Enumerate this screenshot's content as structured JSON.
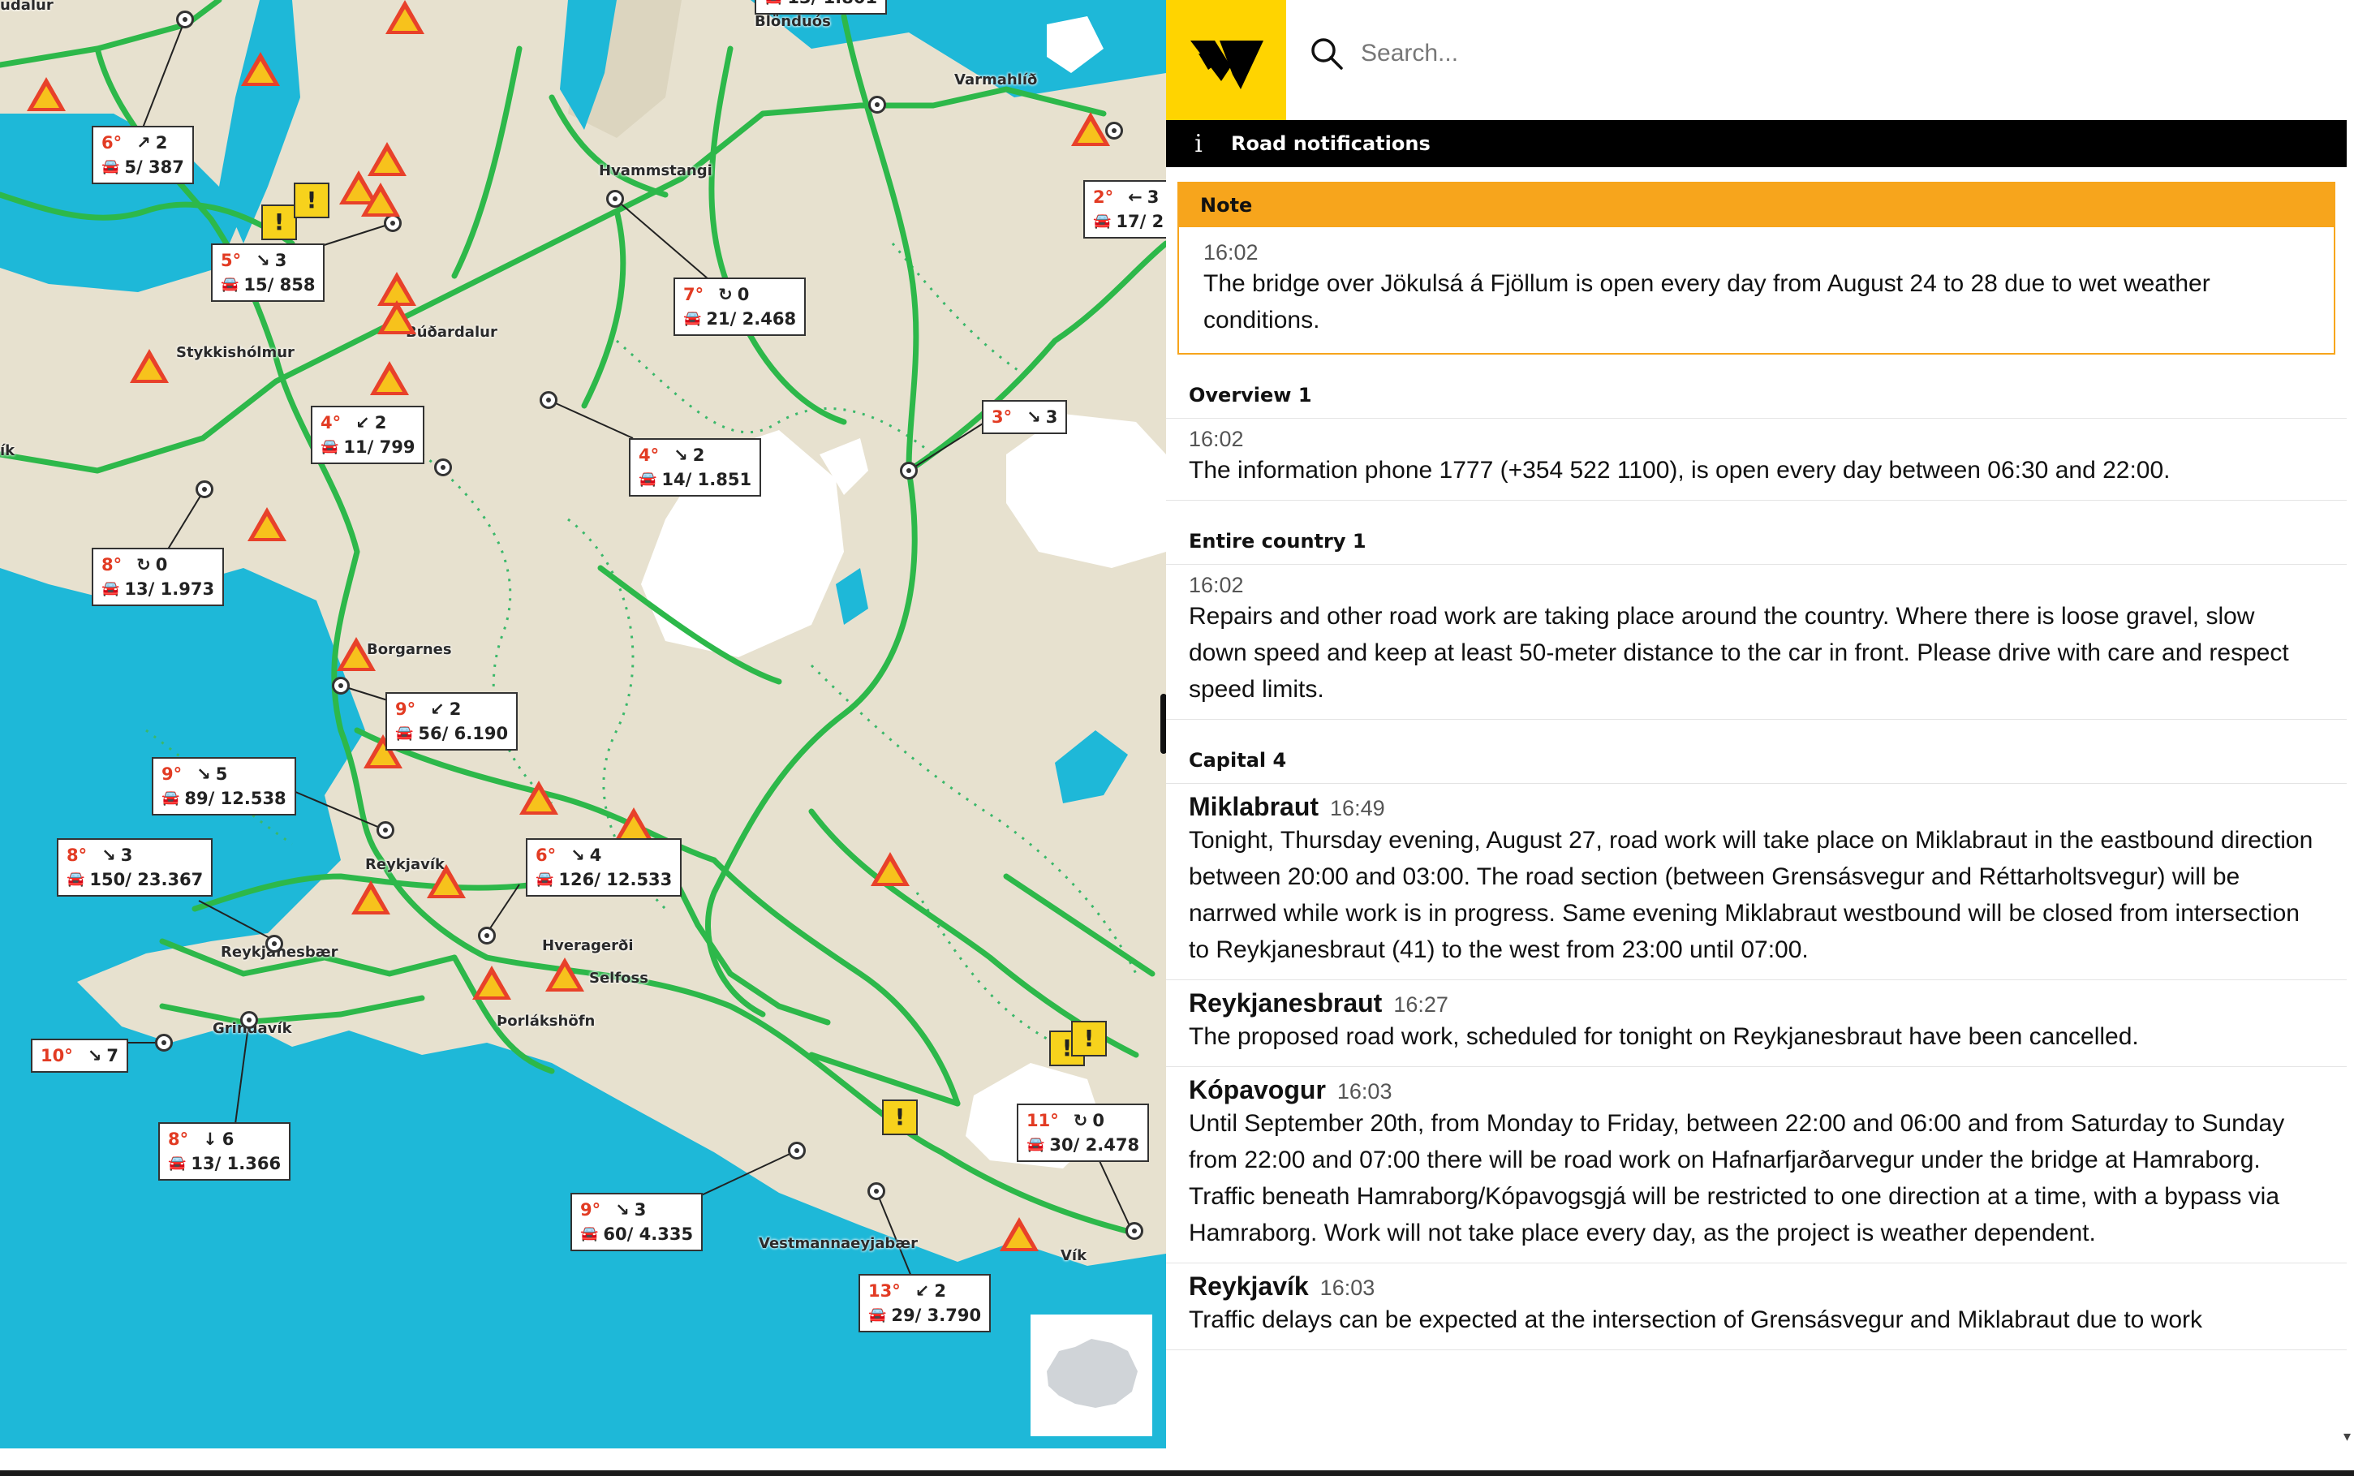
{
  "search": {
    "placeholder": "Search..."
  },
  "notifications": {
    "bar_title": "Road notifications",
    "note": {
      "label": "Note",
      "time": "16:02",
      "text": "The bridge over Jökulsá á Fjöllum is open every day from August 24 to 28 due to wet weather conditions."
    },
    "sections": [
      {
        "head": "Overview 1",
        "items": [
          {
            "title": "",
            "time": "16:02",
            "text": "The information phone 1777 (+354 522 1100), is open every day between 06:30 and 22:00."
          }
        ]
      },
      {
        "head": "Entire country 1",
        "items": [
          {
            "title": "",
            "time": "16:02",
            "text": "Repairs and other road work are taking place around the country. Where there is loose gravel, slow down speed and keep at least 50-meter distance to the car in front. Please drive with care and respect speed limits."
          }
        ]
      },
      {
        "head": "Capital 4",
        "items": [
          {
            "title": "Miklabraut",
            "time": "16:49",
            "text": "Tonight, Thursday evening, August 27, road work will take place on Miklabraut in the eastbound direction between 20:00 and 03:00. The road section (between Grensásvegur and Réttarholtsvegur) will be narrwed while work is in progress. Same evening Miklabraut westbound will be closed from intersection to Reykjanesbraut (41) to the west from 23:00 until 07:00."
          },
          {
            "title": "Reykjanesbraut",
            "time": "16:27",
            "text": "The proposed road work, scheduled for tonight on Reykjanesbraut have been cancelled."
          },
          {
            "title": "Kópavogur",
            "time": "16:03",
            "text": "Until September 20th, from Monday to Friday, between 22:00 and 06:00 and from Saturday to Sunday from 22:00 and 07:00 there will be road work on Hafnarfjarðarvegur under the bridge at Hamraborg. Traffic beneath Hamraborg/Kópavogsgjá will be restricted to one direction at a time, with a bypass via Hamraborg. Work will not take place every day, as the project is weather dependent."
          },
          {
            "title": "Reykjavík",
            "time": "16:03",
            "text": "Traffic delays can be expected at the intersection of Grensásvegur and Miklabraut due to work"
          }
        ]
      }
    ]
  },
  "map": {
    "towns": [
      "udalur",
      "Blönduós",
      "Varmahlíð",
      "Hvammstangi",
      "Stykkishólmur",
      "Búðardalur",
      "ík",
      "Borgarnes",
      "Reykjavík",
      "Reykjanesbær",
      "Hveragerði",
      "Selfoss",
      "Grindavík",
      "Þorlákshöfn",
      "Vestmannaeyjabær",
      "Vík"
    ],
    "stations": [
      {
        "temp": "6°",
        "wind_dir": "↗",
        "wind": "2",
        "traffic": "5/ 387"
      },
      {
        "temp": "5°",
        "wind_dir": "↘",
        "wind": "3",
        "traffic": "15/ 858"
      },
      {
        "temp": "7°",
        "wind_dir": "↻",
        "wind": "0",
        "traffic": "21/ 2.468"
      },
      {
        "temp": "4°",
        "wind_dir": "↙",
        "wind": "2",
        "traffic": "11/ 799"
      },
      {
        "temp": "4°",
        "wind_dir": "↘",
        "wind": "2",
        "traffic": "14/ 1.851"
      },
      {
        "temp": "3°",
        "wind_dir": "↘",
        "wind": "3",
        "traffic": ""
      },
      {
        "temp": "8°",
        "wind_dir": "↻",
        "wind": "0",
        "traffic": "13/ 1.973"
      },
      {
        "temp": "9°",
        "wind_dir": "↙",
        "wind": "2",
        "traffic": "56/ 6.190"
      },
      {
        "temp": "9°",
        "wind_dir": "↘",
        "wind": "5",
        "traffic": "89/ 12.538"
      },
      {
        "temp": "8°",
        "wind_dir": "↘",
        "wind": "3",
        "traffic": "150/ 23.367"
      },
      {
        "temp": "6°",
        "wind_dir": "↘",
        "wind": "4",
        "traffic": "126/ 12.533"
      },
      {
        "temp": "10°",
        "wind_dir": "↘",
        "wind": "7",
        "traffic": ""
      },
      {
        "temp": "8°",
        "wind_dir": "↓",
        "wind": "6",
        "traffic": "13/ 1.366"
      },
      {
        "temp": "11°",
        "wind_dir": "↻",
        "wind": "0",
        "traffic": "30/ 2.478"
      },
      {
        "temp": "9°",
        "wind_dir": "↘",
        "wind": "3",
        "traffic": "60/ 4.335"
      },
      {
        "temp": "13°",
        "wind_dir": "↙",
        "wind": "2",
        "traffic": "29/ 3.790"
      },
      {
        "temp": "2°",
        "wind_dir": "←",
        "wind": "3",
        "traffic": "17/ 2"
      },
      {
        "temp": "",
        "wind_dir": "",
        "wind": "",
        "traffic": "13/ 1.801"
      }
    ]
  },
  "colors": {
    "brand": "#ffd400",
    "note": "#f7a51c",
    "sea": "#1eb8d8",
    "road": "#2db84a"
  }
}
